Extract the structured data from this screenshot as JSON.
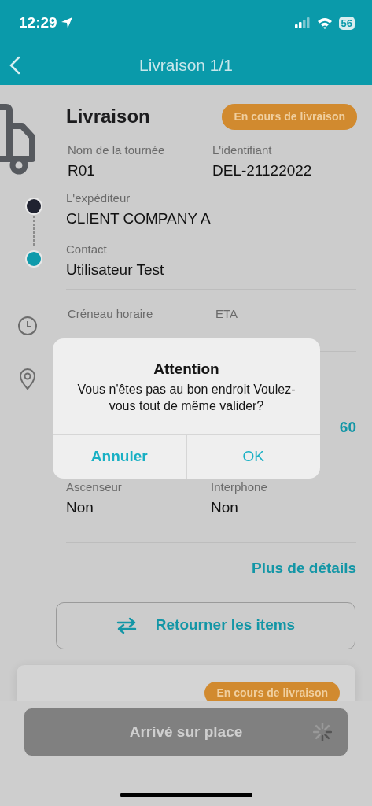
{
  "status_bar": {
    "time": "12:29",
    "battery": "56"
  },
  "nav": {
    "title": "Livraison 1/1"
  },
  "delivery": {
    "title": "Livraison",
    "status": "En cours de livraison",
    "fields": [
      {
        "label": "Nom de la tournée",
        "value": "R01"
      },
      {
        "label": "L'identifiant",
        "value": "DEL-21122022"
      }
    ],
    "timeline": [
      {
        "label": "L'expéditeur",
        "value": "CLIENT COMPANY A",
        "color": "#1f2230"
      },
      {
        "label": "Contact",
        "value": "Utilisateur Test",
        "color": "#0f9aab"
      }
    ],
    "schedule": [
      {
        "label": "Créneau horaire"
      },
      {
        "label": "ETA"
      }
    ],
    "address_partial": "60",
    "access": [
      {
        "label": "Ascenseur",
        "value": "Non"
      },
      {
        "label": "Interphone",
        "value": "Non"
      }
    ],
    "details_link": "Plus de détails",
    "return_button": "Retourner les items"
  },
  "next_card": {
    "status": "En cours de livraison"
  },
  "footer": {
    "button": "Arrivé sur place",
    "loading": true
  },
  "dialog": {
    "title": "Attention",
    "message": "Vous n'êtes pas au bon endroit Voulez-vous tout de même valider?",
    "buttons": [
      {
        "label": "Annuler",
        "kind": "cancel"
      },
      {
        "label": "OK",
        "kind": "default"
      }
    ]
  }
}
